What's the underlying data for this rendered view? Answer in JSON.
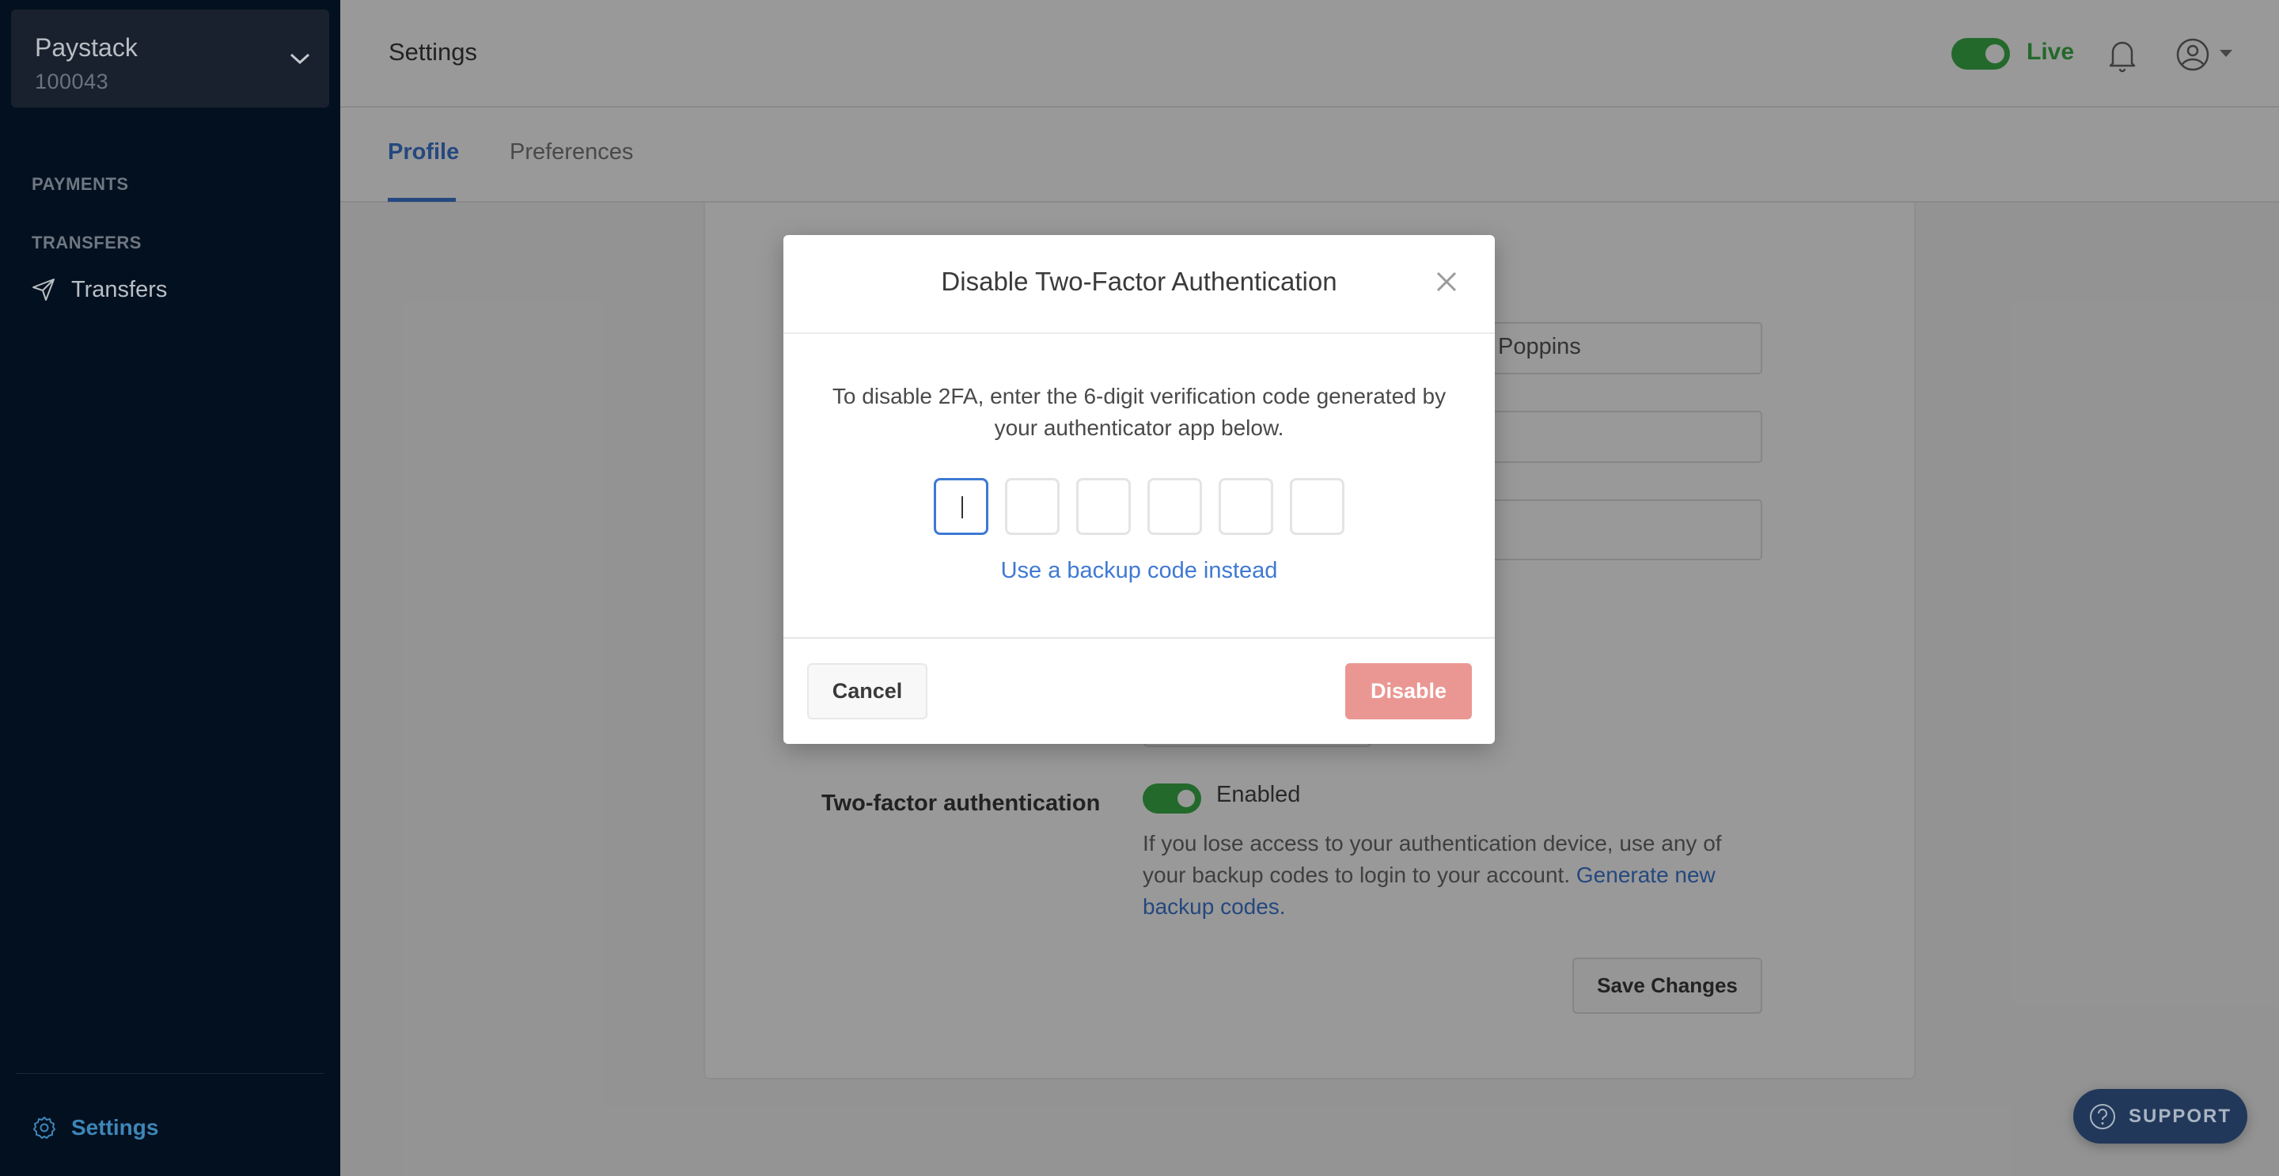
{
  "sidebar": {
    "account": {
      "name": "Paystack",
      "id": "100043"
    },
    "sections": [
      {
        "heading": "PAYMENTS"
      },
      {
        "heading": "TRANSFERS",
        "items": [
          {
            "label": "Transfers",
            "icon": "send-icon"
          }
        ]
      }
    ],
    "footer": {
      "label": "Settings",
      "icon": "gear-icon"
    }
  },
  "header": {
    "title": "Settings",
    "mode_label": "Live",
    "mode_on": true,
    "colors": {
      "live": "#3cb04a",
      "accent": "#3f79d3"
    }
  },
  "tabs": [
    {
      "label": "Profile",
      "active": true
    },
    {
      "label": "Preferences",
      "active": false
    }
  ],
  "profile": {
    "fields": [
      {
        "value": "Poppins"
      },
      {
        "value": ""
      },
      {
        "value": ""
      }
    ],
    "two_factor": {
      "label": "Two-factor authentication",
      "status": "Enabled",
      "enabled": true,
      "description": "If you lose access to your authentication device, use any of your backup codes to login to your account.",
      "link": "Generate new backup codes."
    },
    "save_label": "Save Changes"
  },
  "support": {
    "label": "SUPPORT"
  },
  "modal": {
    "title": "Disable Two-Factor Authentication",
    "text": "To disable 2FA, enter the 6-digit verification code generated by your authenticator app below.",
    "otp_digits": [
      "",
      "",
      "",
      "",
      "",
      ""
    ],
    "backup_link": "Use a backup code instead",
    "cancel_label": "Cancel",
    "disable_label": "Disable",
    "colors": {
      "disable_button": "#ea9793"
    }
  }
}
